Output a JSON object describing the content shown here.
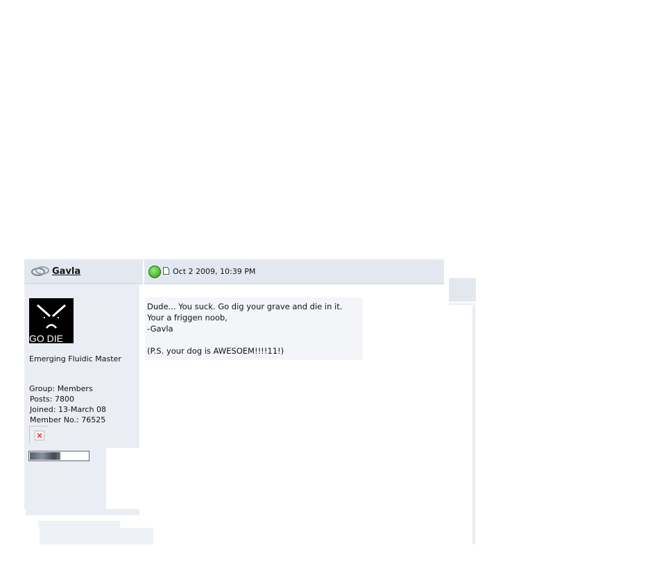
{
  "post": {
    "author": {
      "username": "Gavla",
      "avatar_text": "GO DIE",
      "member_title": "Emerging Fluidic Master",
      "group": "Group: Members",
      "posts": "Posts: 7800",
      "joined": "Joined: 13-March 08",
      "member_no": "Member No.: 76525",
      "reputation_fill_fraction": 0.52
    },
    "date": "Oct 2 2009, 10:39 PM",
    "body": {
      "line1": "Dude... You suck. Go dig your grave and die in it.",
      "line2": "Your a friggen noob,",
      "line3": "-Gavla",
      "line4": "(P.S. your dog is AWESOEM!!!!11!)"
    },
    "icons": {
      "online": "online-status-icon",
      "mood": "mood-icon",
      "post_link": "page-icon",
      "broken_image": "broken-image-icon"
    },
    "colors": {
      "header_bg": "#e3e8f0",
      "profile_bg": "#eaedf3",
      "content_bg": "#f3f5f9"
    }
  }
}
